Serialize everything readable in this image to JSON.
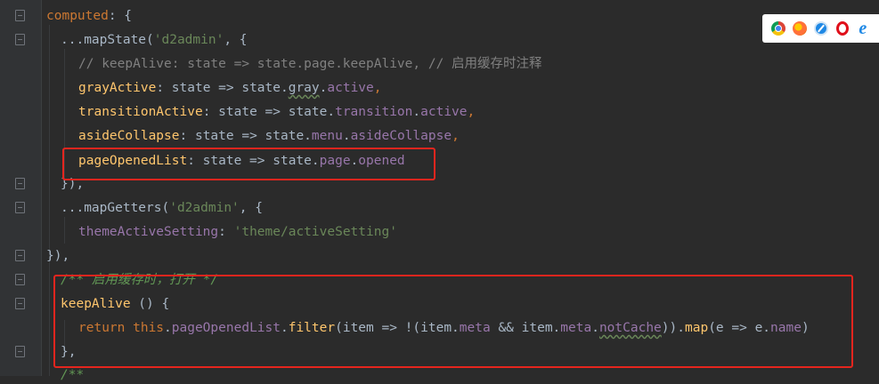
{
  "code": {
    "l1": {
      "a": "computed",
      "b": ": {"
    },
    "l2": {
      "a": "...mapState(",
      "b": "'d2admin'",
      "c": ", {"
    },
    "l3": {
      "a": "// keepAlive: state => state.page.keepAlive, // 启用缓存时注释"
    },
    "l4": {
      "a": "grayActive",
      "b": ": state => state.",
      "c": "gray",
      "d": ".",
      "e": "active",
      "f": ","
    },
    "l5": {
      "a": "transitionActive",
      "b": ": state => state.",
      "c": "transition",
      "d": ".",
      "e": "active",
      "f": ","
    },
    "l6": {
      "a": "asideCollapse",
      "b": ": state => state.",
      "c": "menu",
      "d": ".",
      "e": "asideCollapse",
      "f": ","
    },
    "l7": {
      "a": "pageOpenedList",
      "b": ": state => state.",
      "c": "page",
      "d": ".",
      "e": "opened"
    },
    "l8": {
      "a": "}),"
    },
    "l9": {
      "a": "...mapGetters(",
      "b": "'d2admin'",
      "c": ", {"
    },
    "l10": {
      "a": "themeActiveSetting",
      "b": ": ",
      "c": "'theme/activeSetting'"
    },
    "l11": {
      "a": "}),"
    },
    "l12": {
      "a": "/** 启用缓存时，打开 */"
    },
    "l13": {
      "a": "keepAlive",
      "b": " () {"
    },
    "l14": {
      "a": "return ",
      "b": "this",
      "c": ".",
      "d": "pageOpenedList",
      "e": ".",
      "f": "filter",
      "g": "(item => !(item.",
      "h": "meta",
      "i": " && item.",
      "j": "meta",
      "k": ".",
      "l": "notCache",
      "m": ")).",
      "n": "map",
      "o": "(e => e.",
      "p": "name",
      "q": ")"
    },
    "l15": {
      "a": "},"
    },
    "l16": {
      "a": "/**"
    }
  },
  "browsers": [
    "chrome-icon",
    "firefox-icon",
    "safari-icon",
    "opera-icon",
    "ie-icon"
  ],
  "colors": {
    "highlight": "#e5251e",
    "keyword": "#cc7832",
    "function": "#ffc66d",
    "field": "#9876aa",
    "string": "#6a8759",
    "comment": "#808080"
  }
}
